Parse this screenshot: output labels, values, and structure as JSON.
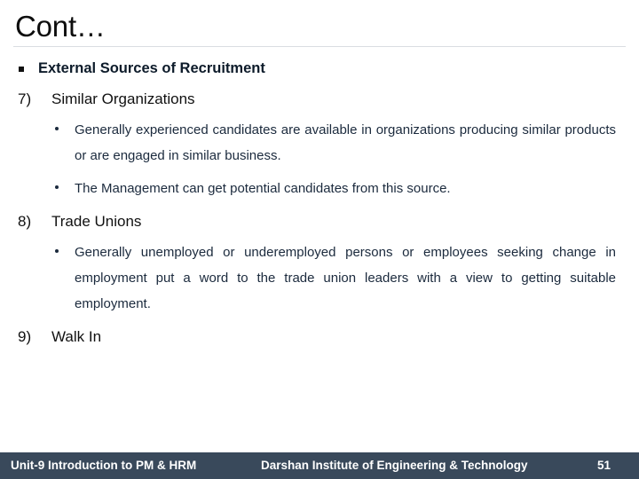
{
  "slide": {
    "title": "Cont…",
    "heading": {
      "bullet": "square-bullet",
      "text": "External Sources of Recruitment"
    },
    "items": [
      {
        "number": "7)",
        "title": "Similar Organizations",
        "bullets": [
          "Generally experienced candidates are available in organizations producing similar products or are engaged in similar business.",
          "The Management can get potential candidates from this source."
        ]
      },
      {
        "number": "8)",
        "title": "Trade Unions",
        "bullets": [
          "Generally unemployed or underemployed persons or employees seeking change in employment put a word to the trade union leaders with a view to getting suitable employment."
        ]
      },
      {
        "number": "9)",
        "title": "Walk In",
        "bullets": []
      }
    ]
  },
  "footer": {
    "left": "Unit-9 Introduction to PM & HRM",
    "center": "Darshan Institute of Engineering & Technology",
    "page_number": "51",
    "background_color": "#39495b",
    "text_color": "#ffffff"
  },
  "colors": {
    "title_text": "#0d0d0d",
    "body_text": "#1b2a3d",
    "rule": "#d9dde2",
    "slide_background": "#ffffff"
  }
}
